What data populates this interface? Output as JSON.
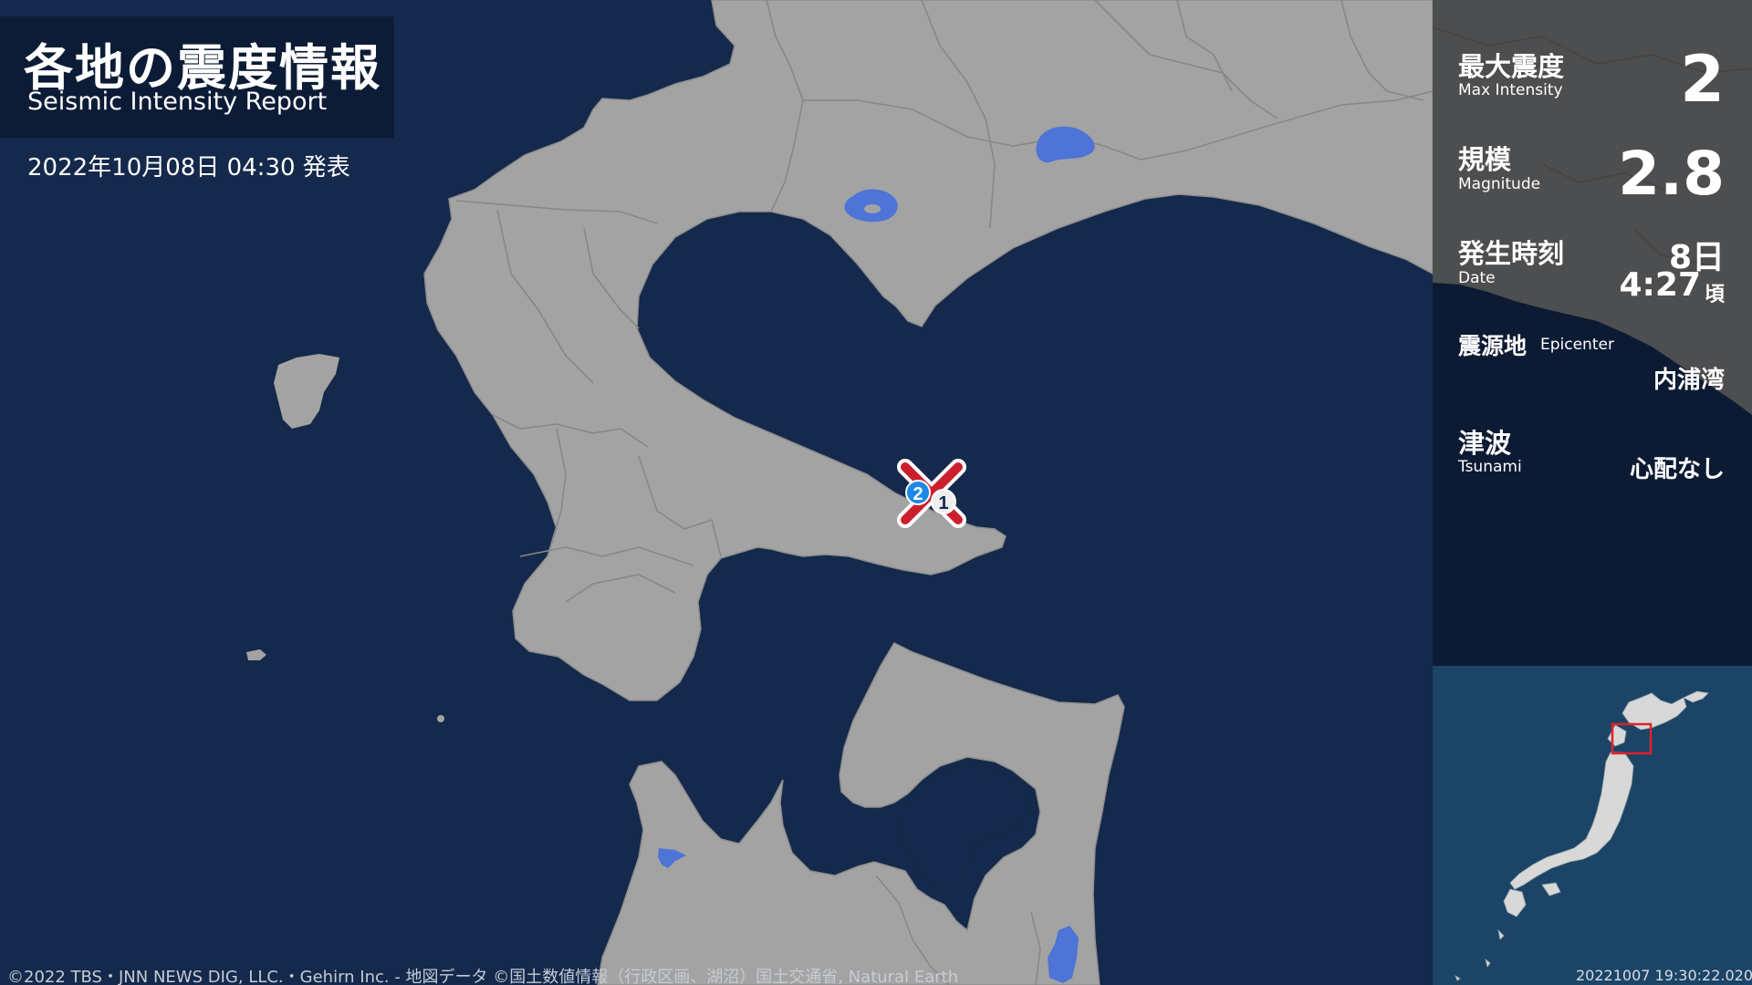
{
  "header": {
    "title_jp": "各地の震度情報",
    "title_en": "Seismic Intensity Report",
    "issued": "2022年10月08日 04:30 発表"
  },
  "summary": {
    "max_intensity": {
      "label_jp": "最大震度",
      "label_en": "Max Intensity",
      "value": "2"
    },
    "magnitude": {
      "label_jp": "規模",
      "label_en": "Magnitude",
      "value": "2.8"
    },
    "date": {
      "label_jp": "発生時刻",
      "label_en": "Date",
      "day": "8日",
      "time": "4:27",
      "approx": "頃"
    },
    "epicenter": {
      "label_jp": "震源地",
      "label_en": "Epicenter",
      "value": "内浦湾"
    },
    "tsunami": {
      "label_jp": "津波",
      "label_en": "Tsunami",
      "value": "心配なし"
    }
  },
  "map": {
    "stations": [
      {
        "intensity": "2",
        "color": "#1e88e5"
      },
      {
        "intensity": "1",
        "color": "#eeeeee"
      }
    ],
    "epicenter_marker_color": "#cc1f2e"
  },
  "colors": {
    "sea": "#14294b",
    "land": "#a3a3a3",
    "lake": "#4d74d6",
    "panel": "#0c1b33",
    "inset_sea": "#1c4466",
    "inset_highlight": "#e0212b"
  },
  "footer": {
    "credits": "©2022 TBS・JNN NEWS DIG, LLC.・Gehirn Inc. - 地図データ ©国土数値情報（行政区画、湖沼）国土交通省, Natural Earth",
    "timestamp": "20221007 19:30:22.020"
  }
}
